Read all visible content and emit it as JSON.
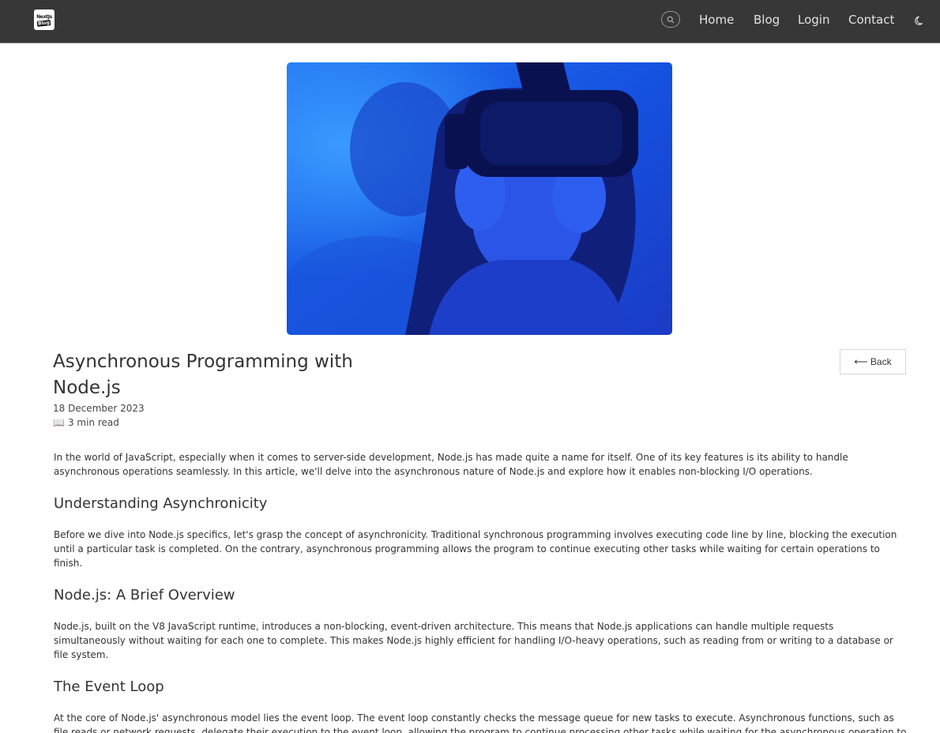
{
  "nav": {
    "logo_top": "NextJs",
    "logo_bottom": "Blog",
    "links": {
      "home": "Home",
      "blog": "Blog",
      "login": "Login",
      "contact": "Contact"
    },
    "icons": {
      "search": "search-icon",
      "theme": "moon-icon"
    }
  },
  "post": {
    "image": "child-wearing-vr-headset-blue",
    "title": "Asynchronous Programming with Node.js",
    "date": "18 December 2023",
    "read_icon": "📖",
    "read_time": "3 min read",
    "back_label": "⟵ Back",
    "sections": [
      {
        "type": "paragraph",
        "text": "In the world of JavaScript, especially when it comes to server-side development, Node.js has made quite a name for itself. One of its key features is its ability to handle asynchronous operations seamlessly. In this article, we'll delve into the asynchronous nature of Node.js and explore how it enables non-blocking I/O operations."
      },
      {
        "type": "heading",
        "text": "Understanding Asynchronicity"
      },
      {
        "type": "paragraph",
        "text": "Before we dive into Node.js specifics, let's grasp the concept of asynchronicity. Traditional synchronous programming involves executing code line by line, blocking the execution until a particular task is completed. On the contrary, asynchronous programming allows the program to continue executing other tasks while waiting for certain operations to finish."
      },
      {
        "type": "heading",
        "text": "Node.js: A Brief Overview"
      },
      {
        "type": "paragraph",
        "text": "Node.js, built on the V8 JavaScript runtime, introduces a non-blocking, event-driven architecture. This means that Node.js applications can handle multiple requests simultaneously without waiting for each one to complete. This makes Node.js highly efficient for handling I/O-heavy operations, such as reading from or writing to a database or file system."
      },
      {
        "type": "heading",
        "text": "The Event Loop"
      },
      {
        "type": "paragraph",
        "text": "At the core of Node.js' asynchronous model lies the event loop. The event loop constantly checks the message queue for new tasks to execute. Asynchronous functions, such as file reads or network requests, delegate their execution to the event loop, allowing the program to continue processing other tasks while waiting for the asynchronous operation to complete."
      }
    ]
  }
}
